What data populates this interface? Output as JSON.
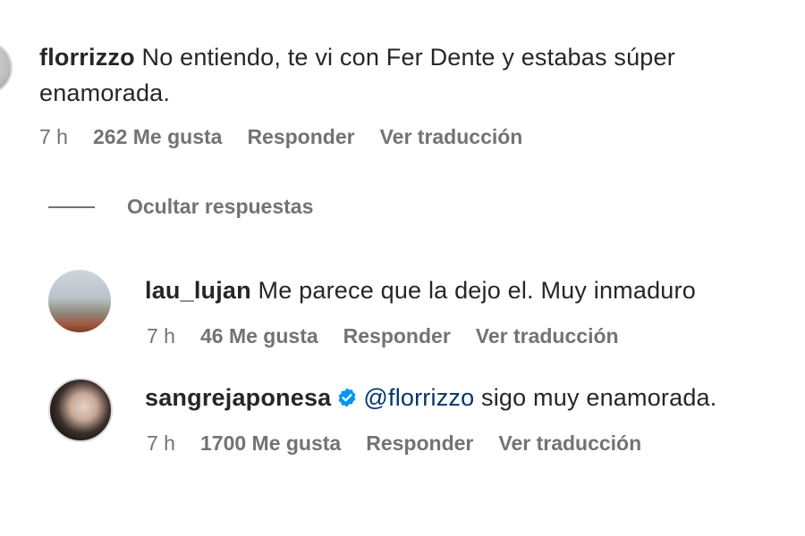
{
  "comments": [
    {
      "username": "florrizzo",
      "text": "No entiendo, te vi con Fer Dente y estabas súper enamorada.",
      "time": "7 h",
      "likes": "262 Me gusta",
      "reply_label": "Responder",
      "translate_label": "Ver traducción"
    }
  ],
  "hide_replies_label": "Ocultar respuestas",
  "replies": [
    {
      "username": "lau_lujan",
      "text": "Me parece que la dejo el. Muy inmaduro",
      "time": "7 h",
      "likes": "46 Me gusta",
      "reply_label": "Responder",
      "translate_label": "Ver traducción"
    },
    {
      "username": "sangrejaponesa",
      "verified": true,
      "mention": "@florrizzo",
      "text": "sigo muy enamorada.",
      "time": "7 h",
      "likes": "1700 Me gusta",
      "reply_label": "Responder",
      "translate_label": "Ver traducción"
    }
  ],
  "colors": {
    "text": "#262626",
    "secondary": "#737373",
    "mention": "#00376b",
    "verified": "#0095f6"
  }
}
